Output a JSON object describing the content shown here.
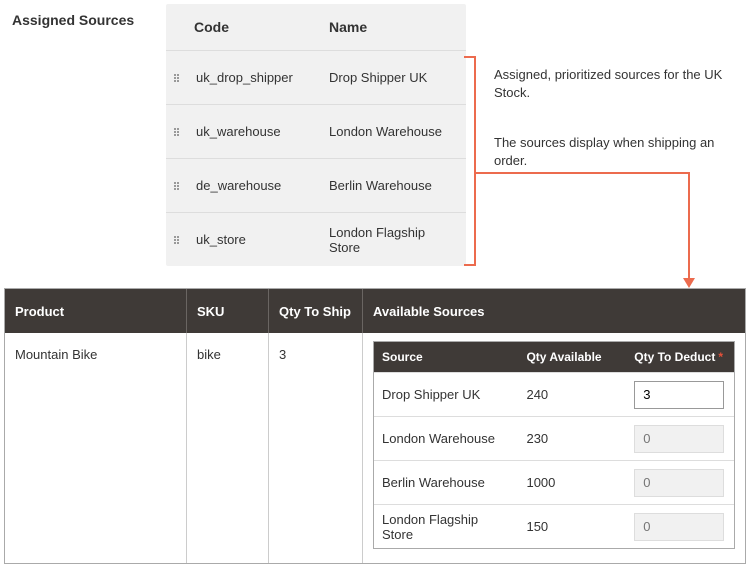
{
  "assigned_sources": {
    "section_label": "Assigned Sources",
    "head_code": "Code",
    "head_name": "Name",
    "rows": [
      {
        "code": "uk_drop_shipper",
        "name": "Drop Shipper UK"
      },
      {
        "code": "uk_warehouse",
        "name": "London Warehouse"
      },
      {
        "code": "de_warehouse",
        "name": "Berlin Warehouse"
      },
      {
        "code": "uk_store",
        "name": "London Flagship Store"
      }
    ]
  },
  "annotations": {
    "line1": "Assigned, prioritized sources for the UK Stock.",
    "line2": "The sources display when shipping an order."
  },
  "shipment": {
    "head_product": "Product",
    "head_sku": "SKU",
    "head_qty": "Qty To Ship",
    "head_sources": "Available Sources",
    "product": "Mountain Bike",
    "sku": "bike",
    "qty_to_ship": "3",
    "nested_head_source": "Source",
    "nested_head_avail": "Qty Available",
    "nested_head_deduct": "Qty To Deduct",
    "sources": [
      {
        "name": "Drop Shipper UK",
        "available": "240",
        "deduct": "3",
        "disabled": false
      },
      {
        "name": "London Warehouse",
        "available": "230",
        "deduct": "",
        "placeholder": "0",
        "disabled": true
      },
      {
        "name": "Berlin Warehouse",
        "available": "1000",
        "deduct": "",
        "placeholder": "0",
        "disabled": true
      },
      {
        "name": "London Flagship Store",
        "available": "150",
        "deduct": "",
        "placeholder": "0",
        "disabled": true
      }
    ]
  }
}
